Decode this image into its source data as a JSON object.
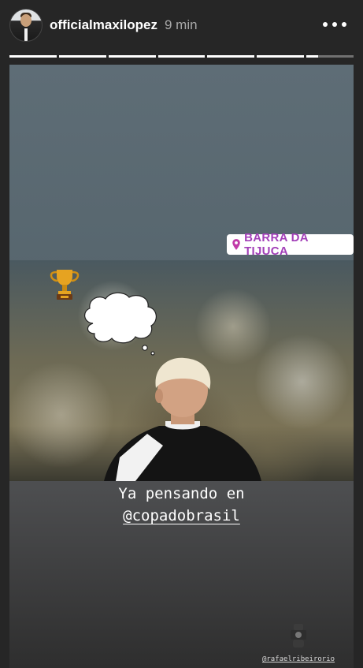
{
  "header": {
    "username": "officialmaxilopez",
    "time": "9 min",
    "progress_segments": 7,
    "progress_last_fill": 0.25
  },
  "story": {
    "location_sticker": "BARRA DA TIJUCA",
    "caption_line1": "Ya pensando en",
    "caption_line2": "@copadobrasil",
    "photo_credit": "@rafaelribeirorio"
  },
  "colors": {
    "location_text": "#a23fb8",
    "background": "#262626"
  },
  "icons": {
    "more": "more-options-icon",
    "pin": "location-pin-icon",
    "trophy": "trophy-emoji",
    "thought": "thought-bubble-sticker",
    "camera": "photographer-camera-icon"
  }
}
